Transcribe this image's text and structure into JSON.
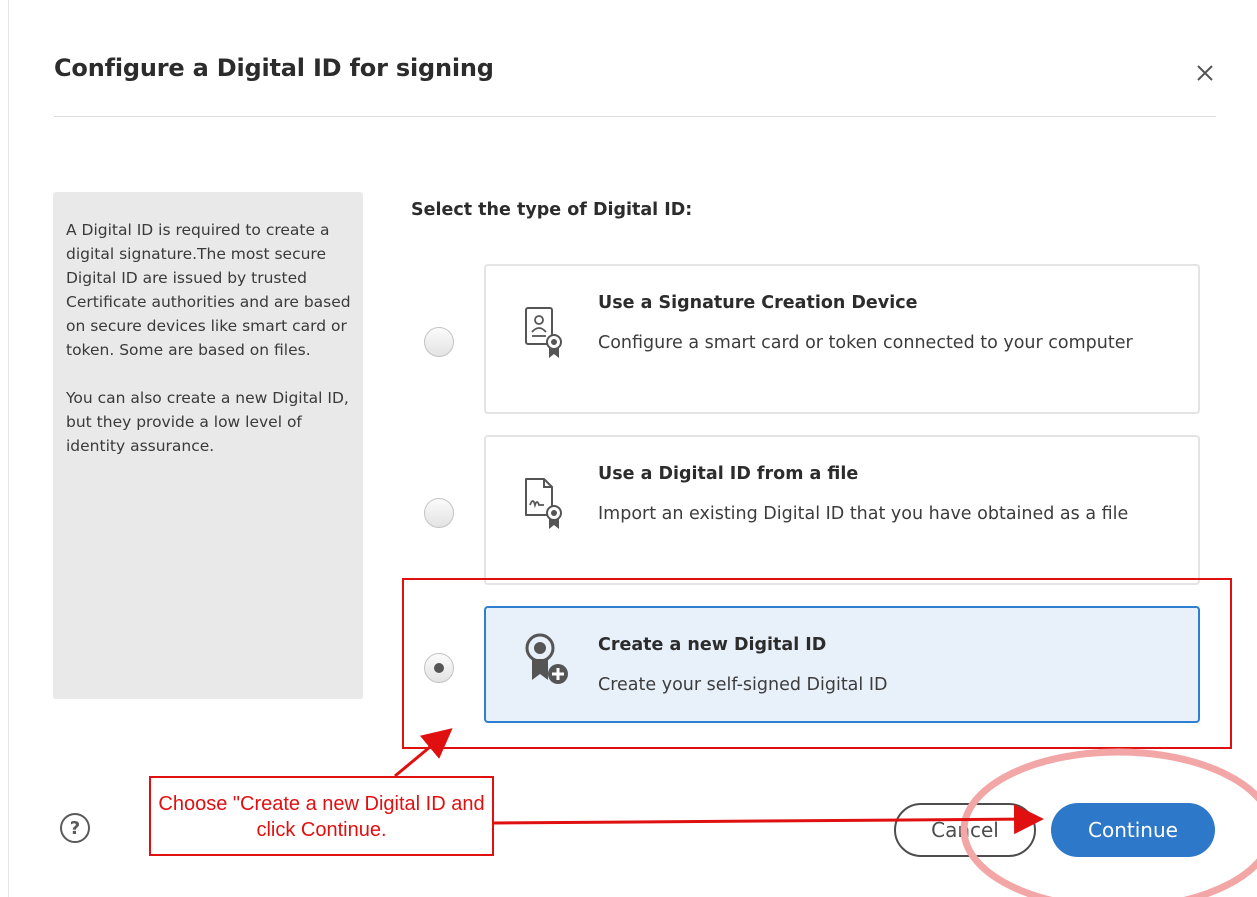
{
  "dialog": {
    "title": "Configure a Digital ID for signing",
    "close_icon": "close-icon"
  },
  "info_panel": {
    "text": "A Digital ID is required to create a digital signature.The most secure Digital ID are issued by trusted Certificate authorities and are based on secure devices like smart card or token. Some are based on files.\n\nYou can also create a new Digital ID, but they provide a low level of identity assurance."
  },
  "selection": {
    "label": "Select the type of Digital ID:",
    "options": [
      {
        "title": "Use a Signature Creation Device",
        "description": "Configure a smart card or token connected to your computer",
        "icon": "certificate-card-icon",
        "selected": false
      },
      {
        "title": "Use a Digital ID from a file",
        "description": "Import an existing Digital ID that you have obtained as a file",
        "icon": "signed-file-icon",
        "selected": false
      },
      {
        "title": "Create a new Digital ID",
        "description": "Create your self-signed Digital ID",
        "icon": "new-digital-id-icon",
        "selected": true
      }
    ]
  },
  "footer": {
    "help_label": "?",
    "cancel_label": "Cancel",
    "continue_label": "Continue"
  },
  "annotation": {
    "callout_text": "Choose \"Create a new Digital ID and click Continue.",
    "color": "#e01010"
  },
  "colors": {
    "accent": "#2d78c9",
    "selected_card_bg": "#e8f0fa",
    "panel_bg": "#e9e9e9"
  }
}
